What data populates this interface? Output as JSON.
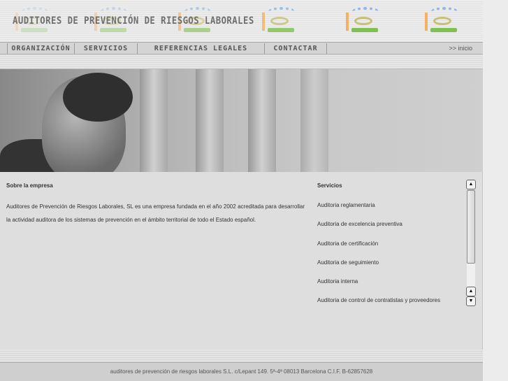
{
  "header": {
    "title": "AUDITORES DE PREVENCIÓN DE RIESGOS LABORALES"
  },
  "nav": {
    "items": [
      "ORGANIZACIÓN",
      "SERVICIOS",
      "REFERENCIAS LEGALES",
      "CONTACTAR"
    ],
    "inicio": ">> inicio"
  },
  "about": {
    "title": "Sobre la empresa",
    "text": "Auditores de Prevención de Riesgos Laborales, SL es una empresa fundada en el año 2002 acreditada para desarrollar la actividad auditora de los sistemas de prevención en el ámbito territorial de todo el Estado español."
  },
  "services": {
    "title": "Servicios",
    "items": [
      "Auditoria reglamentaria",
      "Auditoria de excelencia preventiva",
      "Auditoria de certificación",
      "Auditoria de seguimiento",
      "Auditoria interna",
      "Auditoria de control de contratistas y proveedores"
    ]
  },
  "footer": {
    "text": "auditores de prevención de riesgos laborales S.L. c/Lepant 149. 5ª-4ª 08013 Barcelona C.I.F. B-62857628"
  }
}
